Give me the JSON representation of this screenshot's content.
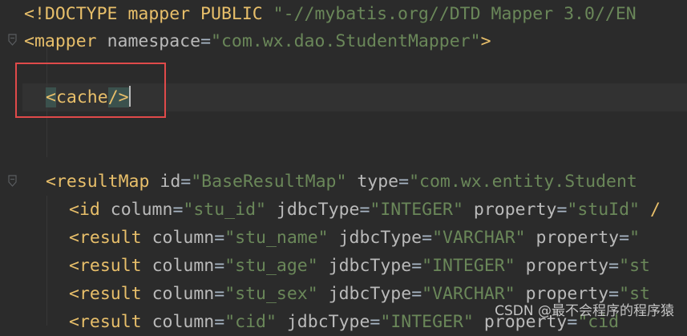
{
  "editor": {
    "language": "xml",
    "lines": [
      {
        "id": "doctype",
        "parts": [
          {
            "text": "<!DOCTYPE mapper PUBLIC ",
            "cls": "t-doctype"
          },
          {
            "text": "\"-//mybatis.org//DTD Mapper 3.0//EN",
            "cls": "t-str"
          }
        ]
      },
      {
        "id": "mapper-open",
        "parts": [
          {
            "text": "<mapper ",
            "cls": "t-tag"
          },
          {
            "text": "namespace",
            "cls": "t-attr"
          },
          {
            "text": "=",
            "cls": "t-eq"
          },
          {
            "text": "\"com.wx.dao.StudentMapper\"",
            "cls": "t-str"
          },
          {
            "text": ">",
            "cls": "t-tag"
          }
        ]
      },
      {
        "id": "cache",
        "parts": [
          {
            "text": "<",
            "cls": "hl-tag"
          },
          {
            "text": "cache",
            "cls": "t-tag"
          },
          {
            "text": "/>",
            "cls": "hl-tag"
          }
        ]
      },
      {
        "id": "resultmap-open",
        "parts": [
          {
            "text": "<resultMap ",
            "cls": "t-tag"
          },
          {
            "text": "id",
            "cls": "t-attr"
          },
          {
            "text": "=",
            "cls": "t-eq"
          },
          {
            "text": "\"BaseResultMap\" ",
            "cls": "t-str"
          },
          {
            "text": "type",
            "cls": "t-attr"
          },
          {
            "text": "=",
            "cls": "t-eq"
          },
          {
            "text": "\"com.wx.entity.Student",
            "cls": "t-str"
          }
        ]
      },
      {
        "id": "id-tag",
        "parts": [
          {
            "text": "<id ",
            "cls": "t-tag"
          },
          {
            "text": "column",
            "cls": "t-attr"
          },
          {
            "text": "=",
            "cls": "t-eq"
          },
          {
            "text": "\"stu_id\" ",
            "cls": "t-str"
          },
          {
            "text": "jdbcType",
            "cls": "t-attr"
          },
          {
            "text": "=",
            "cls": "t-eq"
          },
          {
            "text": "\"INTEGER\" ",
            "cls": "t-str"
          },
          {
            "text": "property",
            "cls": "t-attr"
          },
          {
            "text": "=",
            "cls": "t-eq"
          },
          {
            "text": "\"stuId\" ",
            "cls": "t-str"
          },
          {
            "text": "/",
            "cls": "t-tag"
          }
        ]
      },
      {
        "id": "result-name",
        "parts": [
          {
            "text": "<result ",
            "cls": "t-tag"
          },
          {
            "text": "column",
            "cls": "t-attr"
          },
          {
            "text": "=",
            "cls": "t-eq"
          },
          {
            "text": "\"stu_name\" ",
            "cls": "t-str"
          },
          {
            "text": "jdbcType",
            "cls": "t-attr"
          },
          {
            "text": "=",
            "cls": "t-eq"
          },
          {
            "text": "\"VARCHAR\" ",
            "cls": "t-str"
          },
          {
            "text": "property",
            "cls": "t-attr"
          },
          {
            "text": "=",
            "cls": "t-eq"
          },
          {
            "text": "\"",
            "cls": "t-str"
          }
        ]
      },
      {
        "id": "result-age",
        "parts": [
          {
            "text": "<result ",
            "cls": "t-tag"
          },
          {
            "text": "column",
            "cls": "t-attr"
          },
          {
            "text": "=",
            "cls": "t-eq"
          },
          {
            "text": "\"stu_age\" ",
            "cls": "t-str"
          },
          {
            "text": "jdbcType",
            "cls": "t-attr"
          },
          {
            "text": "=",
            "cls": "t-eq"
          },
          {
            "text": "\"INTEGER\" ",
            "cls": "t-str"
          },
          {
            "text": "property",
            "cls": "t-attr"
          },
          {
            "text": "=",
            "cls": "t-eq"
          },
          {
            "text": "\"st",
            "cls": "t-str"
          }
        ]
      },
      {
        "id": "result-sex",
        "parts": [
          {
            "text": "<result ",
            "cls": "t-tag"
          },
          {
            "text": "column",
            "cls": "t-attr"
          },
          {
            "text": "=",
            "cls": "t-eq"
          },
          {
            "text": "\"stu_sex\" ",
            "cls": "t-str"
          },
          {
            "text": "jdbcType",
            "cls": "t-attr"
          },
          {
            "text": "=",
            "cls": "t-eq"
          },
          {
            "text": "\"VARCHAR\" ",
            "cls": "t-str"
          },
          {
            "text": "property",
            "cls": "t-attr"
          },
          {
            "text": "=",
            "cls": "t-eq"
          },
          {
            "text": "\"st",
            "cls": "t-str"
          }
        ]
      },
      {
        "id": "result-cid",
        "parts": [
          {
            "text": "<result ",
            "cls": "t-tag"
          },
          {
            "text": "column",
            "cls": "t-attr"
          },
          {
            "text": "=",
            "cls": "t-eq"
          },
          {
            "text": "\"cid\" ",
            "cls": "t-str"
          },
          {
            "text": "jdbcType",
            "cls": "t-attr"
          },
          {
            "text": "=",
            "cls": "t-eq"
          },
          {
            "text": "\"INTEGER\" ",
            "cls": "t-str"
          },
          {
            "text": "property",
            "cls": "t-attr"
          },
          {
            "text": "=",
            "cls": "t-eq"
          },
          {
            "text": "\"cid",
            "cls": "t-str"
          }
        ]
      }
    ]
  },
  "annotation": {
    "label": "highlight-box",
    "color": "#e04a4a"
  },
  "watermark": {
    "text": "CSDN @最不会程序的程序猿"
  },
  "colors": {
    "background": "#2b2b2b",
    "tag": "#e8bf6a",
    "attribute": "#bababa",
    "string": "#6a8759",
    "tag_highlight": "#3b514d"
  }
}
